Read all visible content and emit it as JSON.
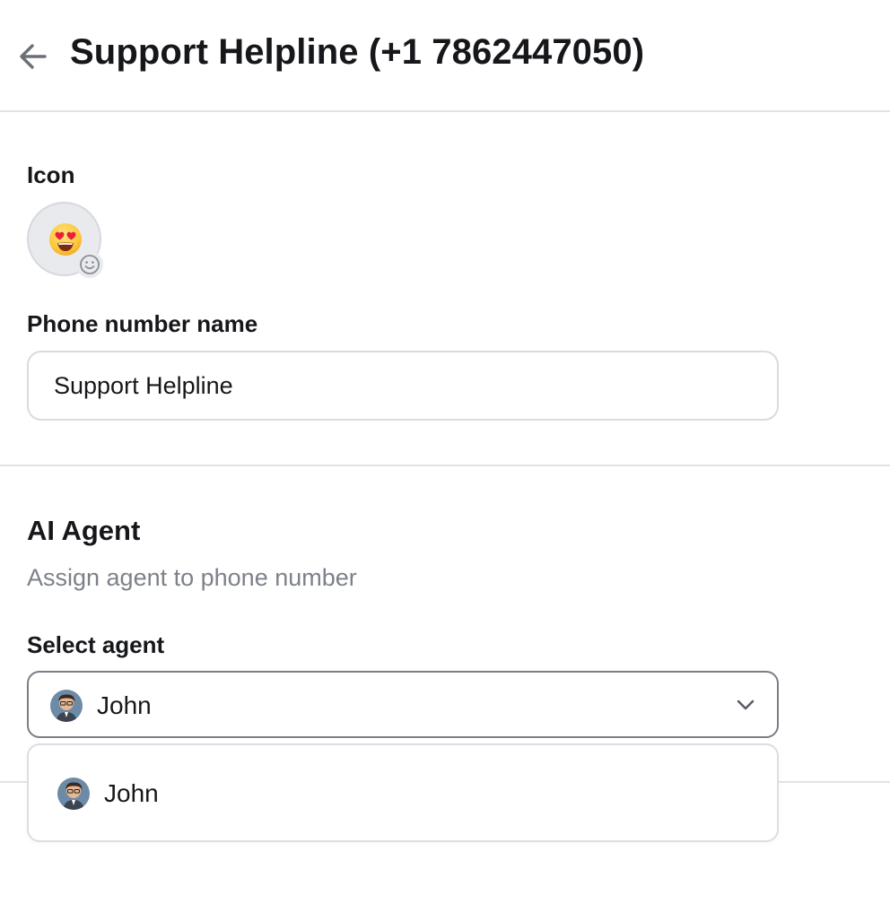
{
  "header": {
    "title": "Support Helpline (+1 7862447050)",
    "back_icon": "arrow-left-icon"
  },
  "icon_field": {
    "label": "Icon",
    "selected_emoji": "smiling-face-with-heart-eyes",
    "edit_icon": "smiley-outline-icon"
  },
  "phone_name_field": {
    "label": "Phone number name",
    "value": "Support Helpline"
  },
  "ai_agent": {
    "title": "AI Agent",
    "description": "Assign agent to phone number",
    "select_label": "Select agent",
    "selected_agent": "John",
    "chevron_icon": "chevron-down-icon",
    "options": [
      {
        "label": "John"
      }
    ]
  },
  "colors": {
    "text": "#15171a",
    "muted_text": "#7d8189",
    "border": "#d9dbe0",
    "focused_border": "#7a7e86",
    "divider": "#e2e3e6"
  }
}
